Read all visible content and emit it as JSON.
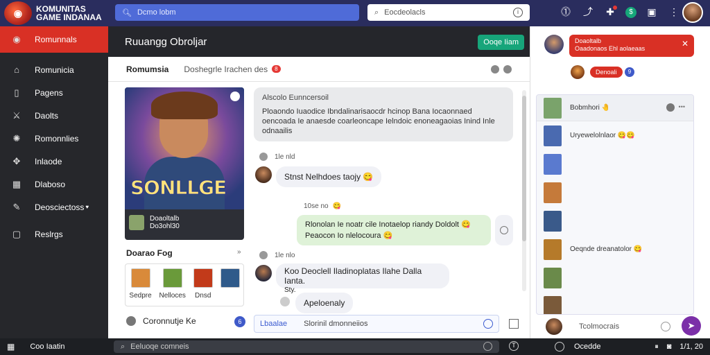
{
  "app": {
    "brand_line1": "KOMUNITAS",
    "brand_line2": "GAME INDANAA",
    "logo_icon": "pokeball-logo-icon"
  },
  "topbar": {
    "search_placeholder": "Dcmo lobm",
    "search2_placeholder": "Eocdeolacls",
    "icons": [
      "alert-circle-icon",
      "share-icon",
      "notification-icon",
      "dollar-icon",
      "chat-icon",
      "more-vertical-icon"
    ]
  },
  "sidebar": {
    "items": [
      {
        "label": "Romunnals",
        "icon": "home-circle-icon",
        "active": true
      },
      {
        "label": "Romunicia",
        "icon": "building-icon"
      },
      {
        "label": "Pagens",
        "icon": "page-icon"
      },
      {
        "label": "Daolts",
        "icon": "sword-icon"
      },
      {
        "label": "Romonnlies",
        "icon": "group-icon"
      },
      {
        "label": "Inlaode",
        "icon": "gamepad-icon"
      },
      {
        "label": "Dlaboso",
        "icon": "calendar-icon"
      },
      {
        "label": "Deosciectoss",
        "icon": "pen-icon",
        "has_badge": true
      },
      {
        "label": "Reslrgs",
        "icon": "settings-icon"
      }
    ]
  },
  "main": {
    "title": "Ruuangg Obroljar",
    "new_button": "Ooqe Iiam",
    "subheader_title": "Romumsia",
    "subheader_desc": "Doshegrle  Irachen  des",
    "subheader_badge": "8",
    "poster": {
      "art_title": "SONLLGE",
      "author_name": "Doaoltalb",
      "author_meta": "Do3ohl30"
    },
    "recent_label": "Doarao Fog",
    "recent_items": [
      {
        "label": "Sedpre",
        "color": "#d98a3a"
      },
      {
        "label": "Nelloces",
        "color": "#6a9a3a"
      },
      {
        "label": "Dnsd",
        "color": "#c23a1a"
      },
      {
        "label": "",
        "color": "#2f5a8a"
      }
    ],
    "footer_label": "Coronnutje Ke",
    "footer_badge": "6"
  },
  "chat": {
    "bubble1_header": "Alscolo Eunncersoil",
    "bubble1_body": "Ploaondo Iuaodice Ibndalinarisaocdr hcinop Bana Iocaonnaed oencoada Ie anaesde coarleoncape Ielndoic enoneagaoias Inind Inle odnaailis",
    "meta1_time": "1le nld",
    "msg1_text": "Stnst  Nelhdoes  taojy",
    "msg1_emoji": "😋",
    "meta2_time": "10se no",
    "meta2_emoji": "😋",
    "green_line1": "Rlonolan Ie noatr cile Inotaelop riandy Doldolt",
    "green_line1_emoji": "😋",
    "green_line2": "Peaocon Io nlelocoura",
    "green_line2_emoji": "😋",
    "meta3_time": "1le nlo",
    "msg2_text": "Koo  Deoclell  Iladinoplatas  Ilahe  Dalla  Ianta.",
    "msg2_sub": "Sty.",
    "msg3_text": "Apeloenaly"
  },
  "input": {
    "label": "Lbaalae",
    "placeholder": "Slorinil dmonneiios"
  },
  "right": {
    "notif_line1": "Doaoltalb",
    "notif_line2": "Oaadonaos Ehl aolaeaas",
    "pill_label": "Denoali",
    "pill_badge": "9",
    "feed": [
      {
        "text": "Bobmhori",
        "emoji": "🤚",
        "color": "#7aa36b",
        "header": true
      },
      {
        "text": "Uryewelolnlaor",
        "emoji": "😋😋",
        "color": "#4a6ab0"
      },
      {
        "text": "",
        "emoji": "",
        "color": "#5a7acf"
      },
      {
        "text": "",
        "emoji": "",
        "color": "#c57a3a"
      },
      {
        "text": "",
        "emoji": "",
        "color": "#3a5a8a"
      },
      {
        "text": "Oeqnde dreanatolor",
        "emoji": "😋",
        "color": "#b57a2a"
      },
      {
        "text": "",
        "emoji": "",
        "color": "#6a8a4a"
      },
      {
        "text": "",
        "emoji": "",
        "color": "#7a5a3a"
      }
    ],
    "footer_text": "Tcolmocrais",
    "fab_icon": "send-icon"
  },
  "bottombar": {
    "left_label": "Coo  Iaatin",
    "search_placeholder": "Eeluoqe comneis",
    "status_label": "Ocedde",
    "right_label": "1/1, 20"
  },
  "colors": {
    "accent_red": "#d93025",
    "accent_green": "#17a57a",
    "topbar_bg": "#2a2d5e",
    "sidebar_bg": "#26272b"
  }
}
